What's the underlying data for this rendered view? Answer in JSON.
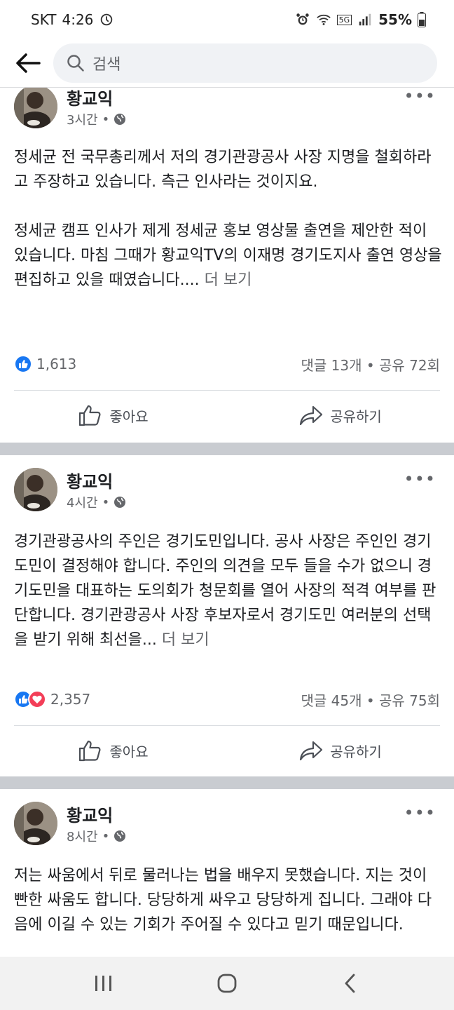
{
  "status_bar": {
    "carrier": "SKT",
    "time": "4:26",
    "network": "5G",
    "battery": "55%"
  },
  "header": {
    "search_placeholder": "검색"
  },
  "posts": [
    {
      "author": "황교익",
      "time": "3시간",
      "paragraphs": [
        "정세균 전 국무총리께서 저의 경기관광공사 사장 지명을 철회하라고 주장하고 있습니다. 측근 인사라는 것이지요.",
        "정세균 캠프 인사가 제게 정세균 홍보 영상물 출연을 제안한 적이 있습니다. 마침 그때가 황교익TV의 이재명 경기도지사 출연 영상을 편집하고 있을 때였습니다...."
      ],
      "see_more": "더 보기",
      "reaction_count": "1,613",
      "comments_shares": "댓글 13개 • 공유 72회",
      "like_label": "좋아요",
      "share_label": "공유하기"
    },
    {
      "author": "황교익",
      "time": "4시간",
      "paragraphs": [
        "경기관광공사의 주인은 경기도민입니다. 공사 사장은 주인인 경기도민이 결정해야 합니다. 주인의 의견을 모두 들을 수가 없으니 경기도민을 대표하는 도의회가 청문회를 열어 사장의 적격 여부를 판단합니다. 경기관광공사 사장 후보자로서 경기도민 여러분의 선택을 받기 위해 최선을..."
      ],
      "see_more": "더 보기",
      "reaction_count": "2,357",
      "comments_shares": "댓글 45개 • 공유 75회",
      "like_label": "좋아요",
      "share_label": "공유하기"
    },
    {
      "author": "황교익",
      "time": "8시간",
      "paragraphs": [
        "저는 싸움에서 뒤로 물러나는 법을 배우지 못했습니다. 지는 것이 빤한 싸움도 합니다. 당당하게 싸우고 당당하게 집니다. 그래야 다음에 이길 수 있는 기회가 주어질 수 있다고 믿기 때문입니다."
      ]
    }
  ],
  "colors": {
    "like_blue": "#1877f2",
    "love_red": "#f33e58",
    "separator": "#c9ccd1"
  }
}
